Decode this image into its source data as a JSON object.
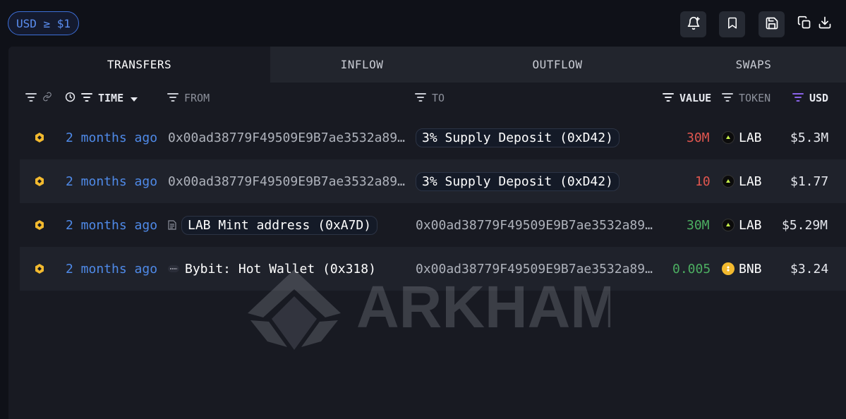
{
  "filter": {
    "label": "USD ≥ $1"
  },
  "toolbar": {
    "icons": [
      "bell-plus-icon",
      "bookmark-icon",
      "save-icon",
      "copy-icon",
      "download-icon"
    ]
  },
  "tabs": [
    {
      "label": "TRANSFERS",
      "active": true
    },
    {
      "label": "INFLOW",
      "active": false
    },
    {
      "label": "OUTFLOW",
      "active": false
    },
    {
      "label": "SWAPS",
      "active": false
    }
  ],
  "columns": {
    "time": "TIME",
    "from": "FROM",
    "to": "TO",
    "value": "VALUE",
    "token": "TOKEN",
    "usd": "USD"
  },
  "rows": [
    {
      "time": "2 months ago",
      "from": "0x00ad38779F49509E9B7ae3532a89…",
      "to": "3% Supply Deposit (0xD42)",
      "value": "30M",
      "token": "LAB",
      "usd": "$5.3M"
    },
    {
      "time": "2 months ago",
      "from": "0x00ad38779F49509E9B7ae3532a89…",
      "to": "3% Supply Deposit (0xD42)",
      "value": "10",
      "token": "LAB",
      "usd": "$1.77"
    },
    {
      "time": "2 months ago",
      "from": "LAB Mint address (0xA7D)",
      "to": "0x00ad38779F49509E9B7ae3532a89…",
      "value": "30M",
      "token": "LAB",
      "usd": "$5.29M"
    },
    {
      "time": "2 months ago",
      "from": "Bybit: Hot Wallet (0x318)",
      "to": "0x00ad38779F49509E9B7ae3532a89…",
      "value": "0.005",
      "token": "BNB",
      "usd": "$3.24"
    }
  ],
  "watermark": {
    "text": "ARKHAM"
  },
  "colors": {
    "accent": "#4f8ae8",
    "negative": "#e0564f",
    "positive": "#4cae61",
    "bnb": "#f3ba2f"
  }
}
